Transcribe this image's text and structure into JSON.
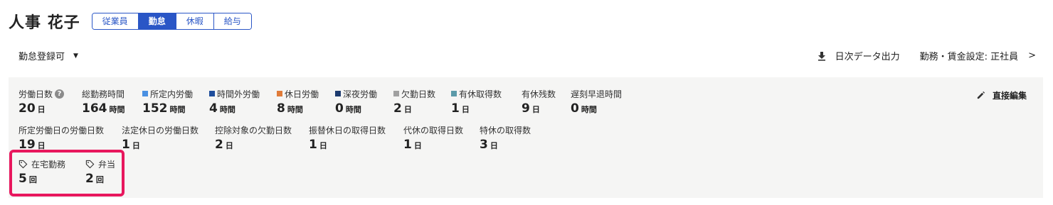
{
  "header": {
    "employee_name": "人事 花子",
    "tabs": [
      {
        "label": "従業員",
        "active": false
      },
      {
        "label": "勤怠",
        "active": true
      },
      {
        "label": "休暇",
        "active": false
      },
      {
        "label": "給与",
        "active": false
      }
    ]
  },
  "toolbar": {
    "status_label": "勤怠登録可",
    "export_label": "日次データ出力",
    "settings_label": "勤務・賃金設定: 正社員"
  },
  "summary": {
    "direct_edit_label": "直接編集",
    "row1": [
      {
        "label": "労働日数",
        "value": "20",
        "unit": "日"
      },
      {
        "label": "総勤務時間",
        "value": "164",
        "unit": "時間"
      },
      {
        "label": "所定内労働",
        "value": "152",
        "unit": "時間"
      },
      {
        "label": "時間外労働",
        "value": "4",
        "unit": "時間"
      },
      {
        "label": "休日労働",
        "value": "8",
        "unit": "時間"
      },
      {
        "label": "深夜労働",
        "value": "0",
        "unit": "時間"
      },
      {
        "label": "欠勤日数",
        "value": "2",
        "unit": "日"
      },
      {
        "label": "有休取得数",
        "value": "1",
        "unit": "日"
      },
      {
        "label": "有休残数",
        "value": "9",
        "unit": "日"
      },
      {
        "label": "遅刻早退時間",
        "value": "0",
        "unit": "時間"
      }
    ],
    "row2": [
      {
        "label": "所定労働日の労働日数",
        "value": "19",
        "unit": "日"
      },
      {
        "label": "法定休日の労働日数",
        "value": "1",
        "unit": "日"
      },
      {
        "label": "控除対象の欠勤日数",
        "value": "2",
        "unit": "日"
      },
      {
        "label": "振替休日の取得日数",
        "value": "1",
        "unit": "日"
      },
      {
        "label": "代休の取得日数",
        "value": "1",
        "unit": "日"
      },
      {
        "label": "特休の取得数",
        "value": "3",
        "unit": "日"
      }
    ],
    "tags": [
      {
        "label": "在宅勤務",
        "value": "5",
        "unit": "回"
      },
      {
        "label": "弁当",
        "value": "2",
        "unit": "回"
      }
    ]
  },
  "colors": {
    "accent": "#2a56c6",
    "scheduled_work": "#4a90e2",
    "overtime": "#1f4e9c",
    "holiday_work": "#e07b39",
    "night_work": "#1c3a6e",
    "absence": "#a0a0a0",
    "paid_leave": "#5b9aa9",
    "highlight": "#e8175d"
  },
  "icons": {
    "help": "question-circle-icon",
    "download": "download-icon",
    "edit": "pencil-icon",
    "tag": "tag-icon",
    "caret": "caret-down-icon",
    "chevron": "chevron-right-icon"
  }
}
